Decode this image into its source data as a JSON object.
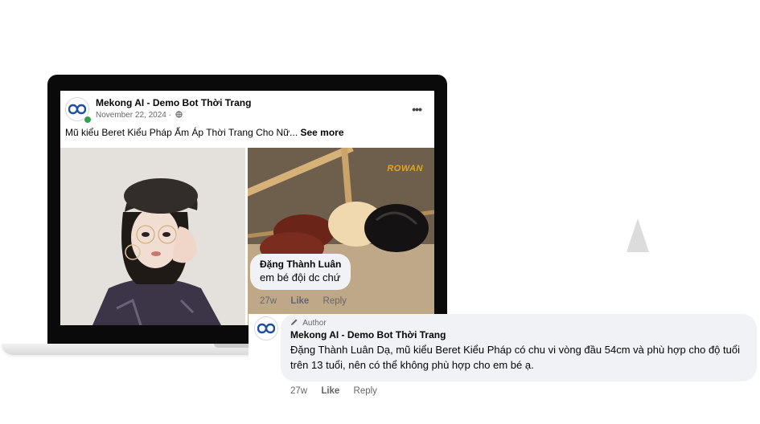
{
  "post": {
    "page_name": "Mekong AI - Demo Bot Thời Trang",
    "date": "November 22, 2024 ·",
    "text": "Mũ kiểu Beret Kiểu Pháp Ấm Áp Thời Trang Cho Nữ...",
    "see_more": "See more",
    "more_icon": "•••",
    "brand_watermark": "ROWAN"
  },
  "comments": [
    {
      "author": "Đặng Thành Luân",
      "text": "em bé đội dc chứ",
      "time": "27w",
      "like": "Like",
      "reply": "Reply"
    },
    {
      "badge": "Author",
      "author": "Mekong AI - Demo Bot Thời Trang",
      "text": "Đặng Thành Luân Dạ, mũ kiểu Beret Kiểu Pháp có chu vi vòng đầu 54cm và phù hợp cho độ tuổi trên 13 tuổi, nên có thể không phù hợp cho em bé ạ.",
      "time": "27w",
      "like": "Like",
      "reply": "Reply"
    }
  ],
  "colors": {
    "online": "#31a24c",
    "bubble": "#f0f2f5",
    "muted": "#65676b",
    "logo": "#1e4fa3"
  }
}
